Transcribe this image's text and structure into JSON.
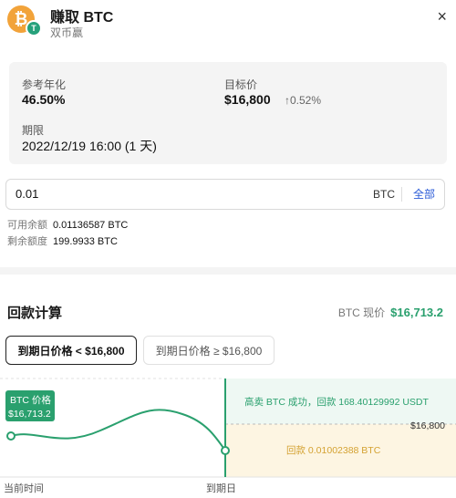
{
  "header": {
    "coin_symbol": "₿",
    "badge": "T",
    "title": "赚取 BTC",
    "subtitle": "双币赢",
    "close": "×"
  },
  "info": {
    "ref_apr_label": "参考年化",
    "ref_apr_value": "46.50%",
    "target_label": "目标价",
    "target_value": "$16,800",
    "target_change": "↑0.52%",
    "term_label": "期限",
    "term_value": "2022/12/19 16:00 (1 天)"
  },
  "amount": {
    "value": "0.01",
    "unit": "BTC",
    "all_label": "全部"
  },
  "balance": {
    "available_label": "可用余额",
    "available_value": "0.01136587 BTC",
    "remaining_label": "剩余额度",
    "remaining_value": "199.9933 BTC"
  },
  "calc": {
    "title": "回款计算",
    "current_label": "BTC 现价",
    "current_value": "$16,713.2",
    "tabs": [
      {
        "label": "到期日价格 < $16,800"
      },
      {
        "label": "到期日价格 ≥ $16,800"
      }
    ]
  },
  "chart_data": {
    "type": "line",
    "tag_title": "BTC 价格",
    "tag_value": "$16,713.2",
    "target_price": 16800,
    "target_label": "$16,800",
    "upper_text": "高卖 BTC 成功，回款 168.40129992 USDT",
    "lower_text": "回款 0.01002388 BTC",
    "x_start": "当前时间",
    "x_end": "到期日",
    "colors": {
      "line": "#2aa06e",
      "upper_fill": "#eef8f3",
      "lower_fill": "#fdf5e2",
      "lower_text": "#d4a232",
      "upper_text": "#2aa06e"
    }
  }
}
